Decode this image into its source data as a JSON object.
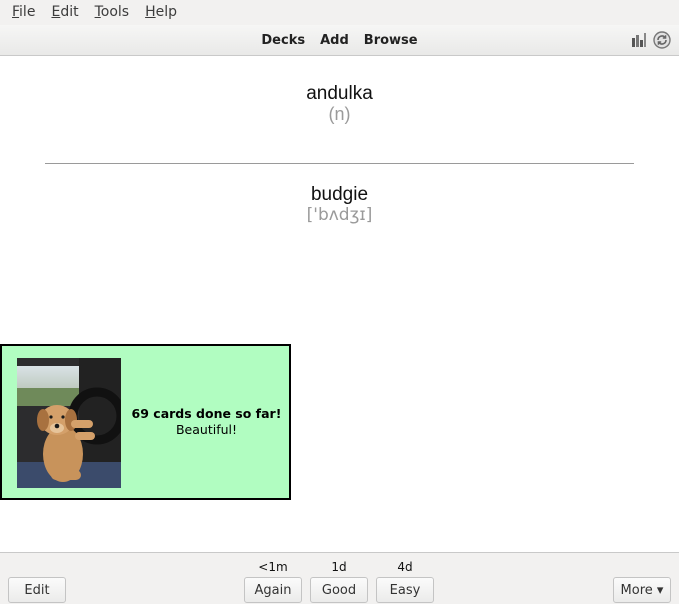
{
  "menubar": {
    "items": [
      {
        "first": "F",
        "rest": "ile"
      },
      {
        "first": "E",
        "rest": "dit"
      },
      {
        "first": "T",
        "rest": "ools"
      },
      {
        "first": "H",
        "rest": "elp"
      }
    ]
  },
  "toolbar": {
    "decks": "Decks",
    "add": "Add",
    "browse": "Browse",
    "icons": [
      "stats-icon",
      "sync-icon"
    ]
  },
  "card": {
    "front_word": "andulka",
    "front_hint": "(n)",
    "back_word": "budgie",
    "back_ipa": "['bʌdʒɪ]"
  },
  "encouragement": {
    "count_text": "69 cards done so far!",
    "praise": "Beautiful!",
    "background": "#b1fdc1"
  },
  "answer_bar": {
    "edit_label": "Edit",
    "more_label": "More ▾",
    "buttons": [
      {
        "label": "Again",
        "interval": "<1m"
      },
      {
        "label": "Good",
        "interval": "1d"
      },
      {
        "label": "Easy",
        "interval": "4d"
      }
    ]
  }
}
